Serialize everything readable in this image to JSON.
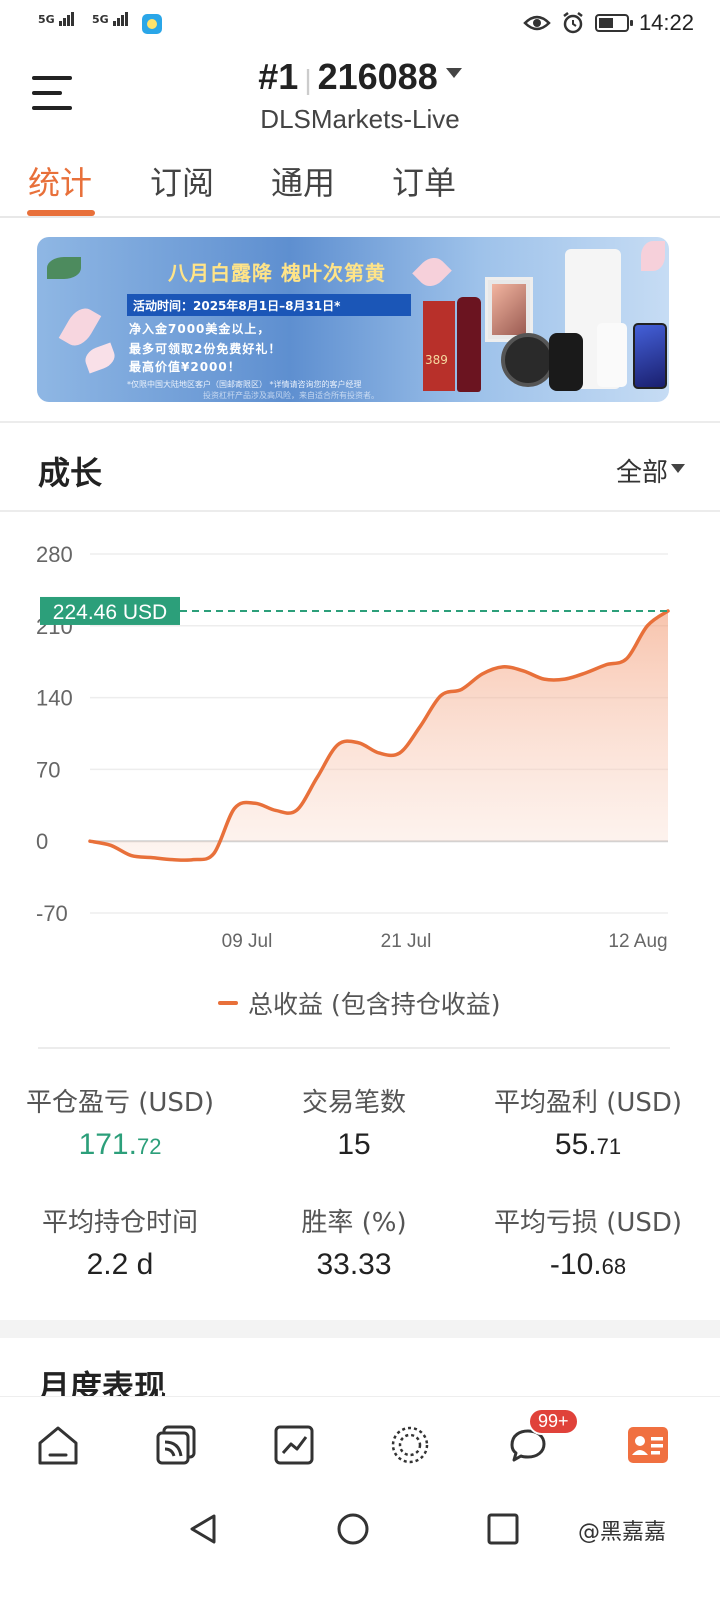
{
  "status_bar": {
    "sim1": "5G",
    "sim2": "5G",
    "time": "14:22"
  },
  "header": {
    "account_number": "#1",
    "account_id": "216088",
    "server": "DLSMarkets-Live"
  },
  "tabs": [
    {
      "label": "统计",
      "active": true
    },
    {
      "label": "订阅",
      "active": false
    },
    {
      "label": "通用",
      "active": false
    },
    {
      "label": "订单",
      "active": false
    }
  ],
  "banner": {
    "title": "八月白露降  槐叶次第黄",
    "date_line": "活动时间：2025年8月1日–8月31日*",
    "line1": "净入金7000美金以上，",
    "line2": "最多可领取2份免费好礼！",
    "line3": "最高价值¥2000！",
    "note1": "*仅限中国大陆地区客户（国邮寄限区）  *详情请咨询您的客户经理",
    "note2": "投资杠杆产品涉及高风险，来自适合所有投资者。",
    "price_tag": "389"
  },
  "growth": {
    "title": "成长",
    "range_label": "全部"
  },
  "chart_data": {
    "type": "area",
    "ylim": [
      -70,
      280
    ],
    "y_ticks": [
      "280",
      "210",
      "140",
      "70",
      "0",
      "-70"
    ],
    "x_ticks": [
      "09 Jul",
      "21 Jul",
      "12 Aug"
    ],
    "current_label": "224.46 USD",
    "current_value": 224.46,
    "series": [
      {
        "name": "总收益 (包含持仓收益)",
        "color": "#e8703a",
        "values": [
          0,
          -4,
          -14,
          -16,
          -18,
          -18,
          -12,
          32,
          37,
          30,
          30,
          62,
          94,
          96,
          86,
          86,
          112,
          142,
          148,
          163,
          170,
          166,
          158,
          158,
          164,
          172,
          178,
          210,
          224.46
        ]
      }
    ]
  },
  "legend": {
    "label": "总收益 (包含持仓收益)"
  },
  "stats": [
    {
      "label": "平仓盈亏 (USD)",
      "int": "171.",
      "frac": "72",
      "color": "#2c9f7a"
    },
    {
      "label": "交易笔数",
      "int": "15",
      "frac": ""
    },
    {
      "label": "平均盈利 (USD)",
      "int": "55.",
      "frac": "71"
    },
    {
      "label": "平均持仓时间",
      "int": "2.2 d",
      "frac": ""
    },
    {
      "label": "胜率 (%)",
      "int": "33.33",
      "frac": ""
    },
    {
      "label": "平均亏损 (USD)",
      "int": "-10.",
      "frac": "68"
    }
  ],
  "monthly": {
    "title": "月度表现"
  },
  "bottom_nav": {
    "items": [
      "home-icon",
      "copy-trade-icon",
      "chart-icon",
      "community-icon",
      "chat-icon",
      "profile-card-icon"
    ],
    "chat_badge": "99+",
    "active_color": "#f07040"
  },
  "watermark": "@黑嘉嘉",
  "colors": {
    "accent": "#e8703a",
    "label_green": "#2c9f7a"
  }
}
